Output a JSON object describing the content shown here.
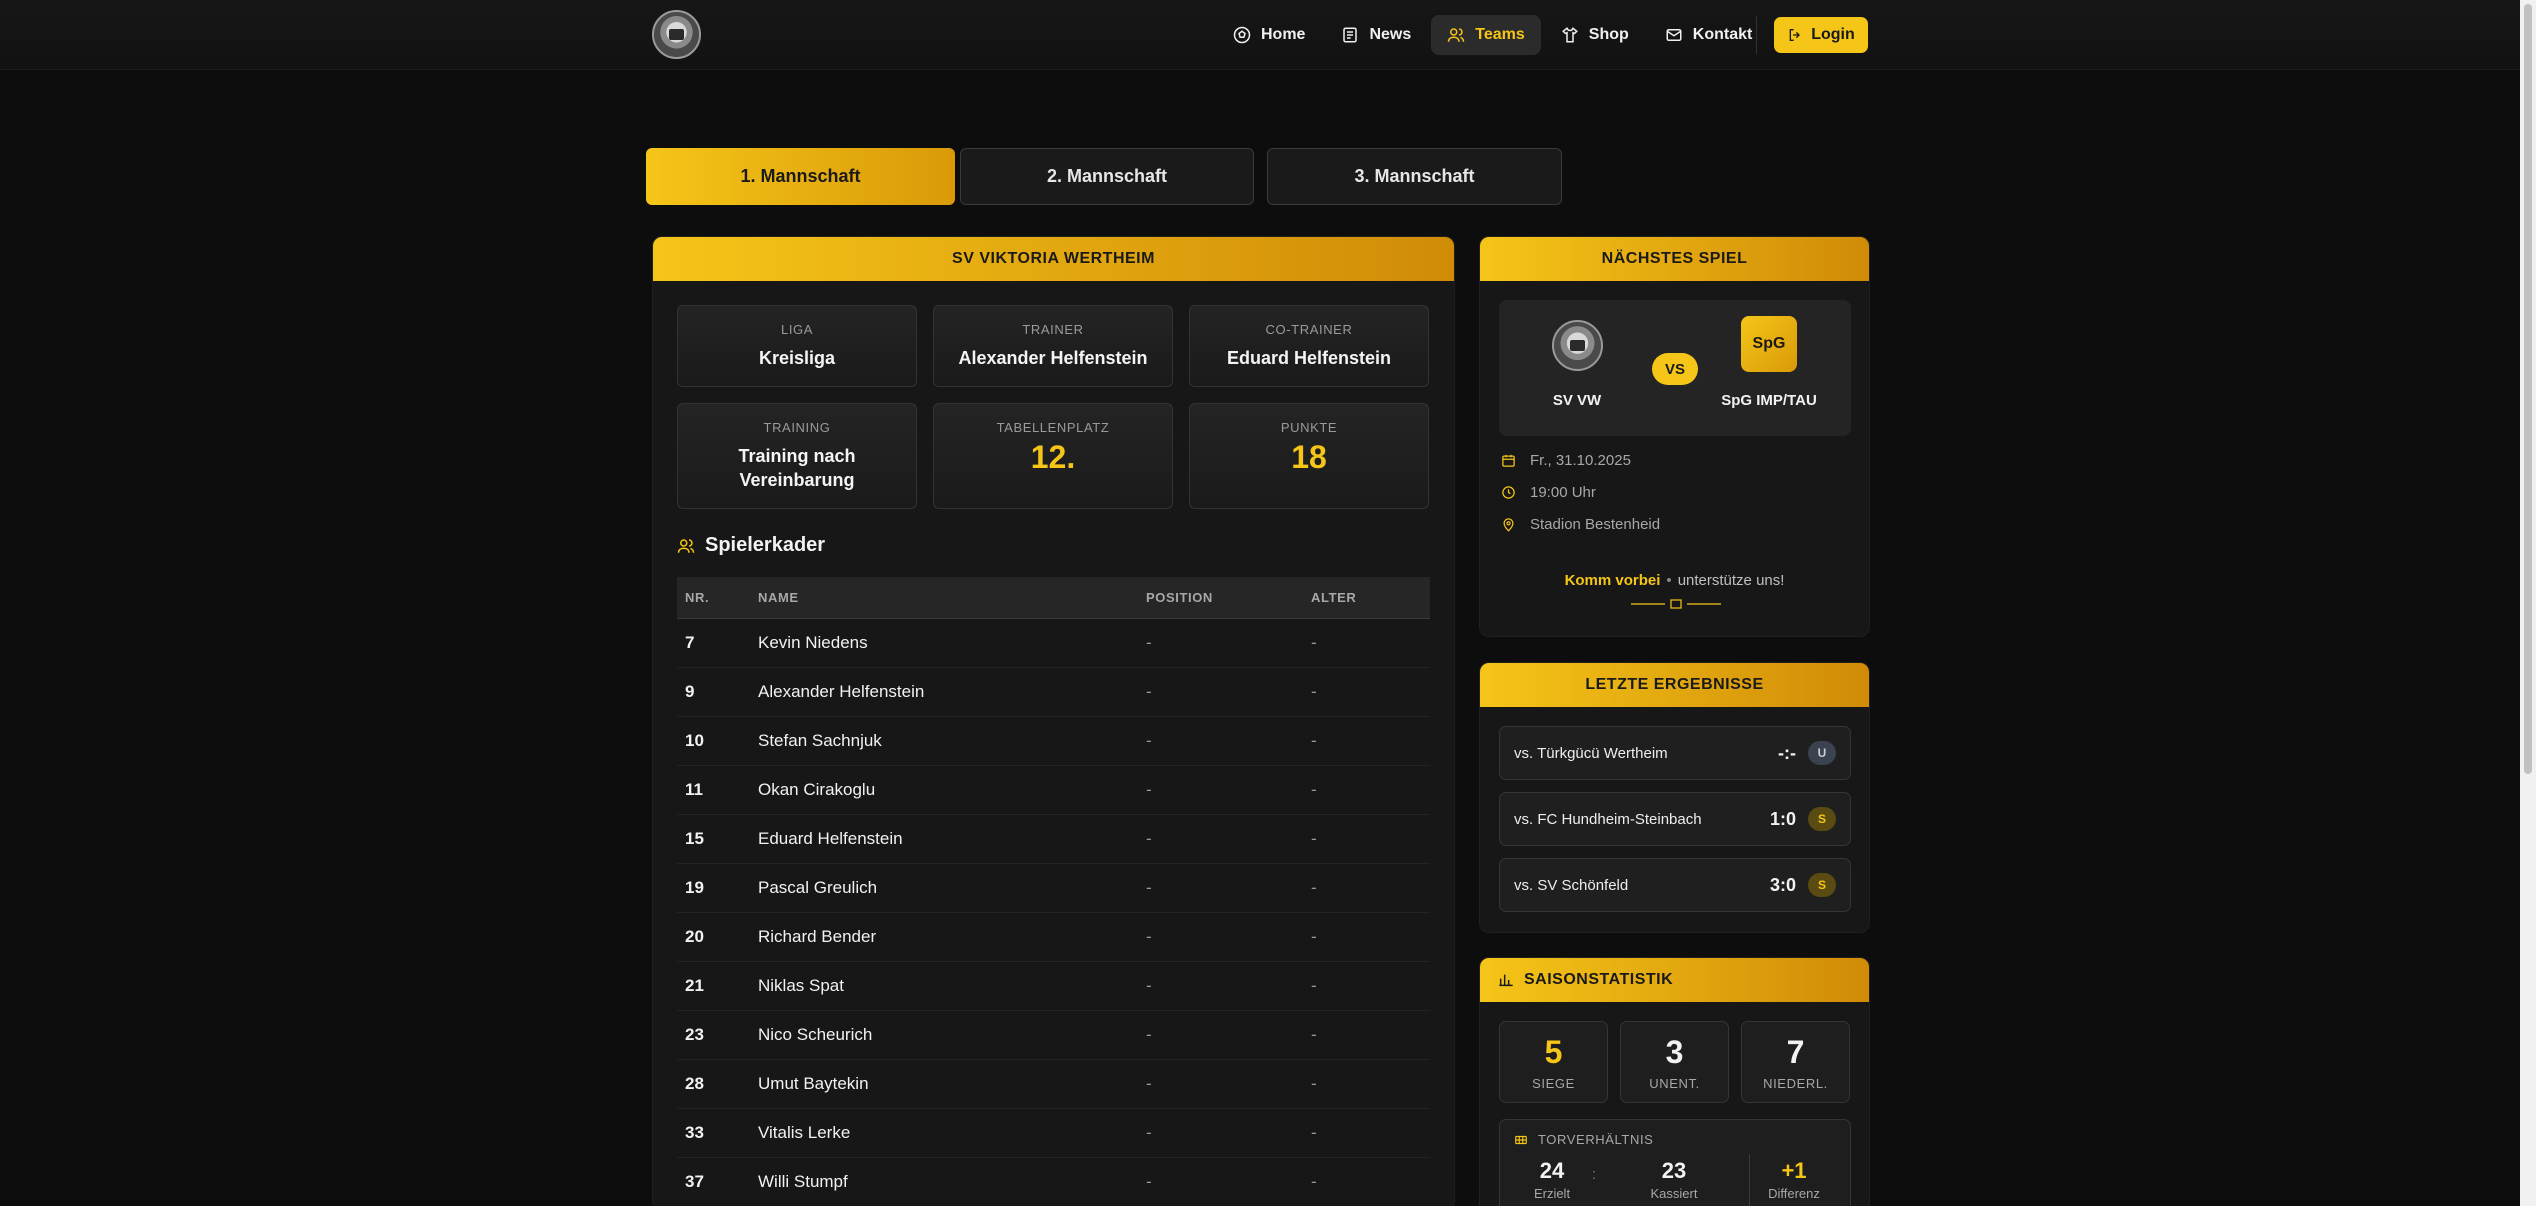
{
  "nav": {
    "items": [
      {
        "label": "Home",
        "icon": "soccer-ball-icon"
      },
      {
        "label": "News",
        "icon": "newspaper-icon"
      },
      {
        "label": "Teams",
        "icon": "users-icon",
        "active": true
      },
      {
        "label": "Shop",
        "icon": "shirt-icon"
      },
      {
        "label": "Kontakt",
        "icon": "mail-icon"
      }
    ],
    "login_label": "Login"
  },
  "tabs": [
    "1. Mannschaft",
    "2. Mannschaft",
    "3. Mannschaft"
  ],
  "team": {
    "header": "SV VIKTORIA WERTHEIM",
    "info": [
      {
        "label": "Liga",
        "value": "Kreisliga"
      },
      {
        "label": "Trainer",
        "value": "Alexander Helfenstein"
      },
      {
        "label": "Co-Trainer",
        "value": "Eduard Helfenstein"
      },
      {
        "label": "Training",
        "value": "Training nach Vereinbarung"
      },
      {
        "label": "Tabellenplatz",
        "value": "12."
      },
      {
        "label": "Punkte",
        "value": "18"
      }
    ],
    "squad_title": "Spielerkader",
    "columns": [
      "NR.",
      "NAME",
      "POSITION",
      "ALTER"
    ],
    "players": [
      {
        "nr": "7",
        "name": "Kevin Niedens",
        "position": "-",
        "age": "-"
      },
      {
        "nr": "9",
        "name": "Alexander Helfenstein",
        "position": "-",
        "age": "-"
      },
      {
        "nr": "10",
        "name": "Stefan Sachnjuk",
        "position": "-",
        "age": "-"
      },
      {
        "nr": "11",
        "name": "Okan Cirakoglu",
        "position": "-",
        "age": "-"
      },
      {
        "nr": "15",
        "name": "Eduard Helfenstein",
        "position": "-",
        "age": "-"
      },
      {
        "nr": "19",
        "name": "Pascal Greulich",
        "position": "-",
        "age": "-"
      },
      {
        "nr": "20",
        "name": "Richard Bender",
        "position": "-",
        "age": "-"
      },
      {
        "nr": "21",
        "name": "Niklas Spat",
        "position": "-",
        "age": "-"
      },
      {
        "nr": "23",
        "name": "Nico Scheurich",
        "position": "-",
        "age": "-"
      },
      {
        "nr": "28",
        "name": "Umut Baytekin",
        "position": "-",
        "age": "-"
      },
      {
        "nr": "33",
        "name": "Vitalis Lerke",
        "position": "-",
        "age": "-"
      },
      {
        "nr": "37",
        "name": "Willi Stumpf",
        "position": "-",
        "age": "-"
      }
    ]
  },
  "next_match": {
    "header": "NÄCHSTES SPIEL",
    "home": "SV VW",
    "away_logo": "SpG",
    "away": "SpG IMP/TAU",
    "vs": "VS",
    "date": "Fr., 31.10.2025",
    "time": "19:00 Uhr",
    "venue": "Stadion Bestenheid",
    "cta_bold": "Komm vorbei",
    "cta_rest": "unterstütze uns!"
  },
  "results": {
    "header": "LETZTE ERGEBNISSE",
    "items": [
      {
        "opponent": "vs. Türkgücü Wertheim",
        "score": "-:-",
        "badge": "U"
      },
      {
        "opponent": "vs. FC Hundheim-Steinbach",
        "score": "1:0",
        "badge": "S"
      },
      {
        "opponent": "vs. SV Schönfeld",
        "score": "3:0",
        "badge": "S"
      }
    ]
  },
  "season": {
    "header": "SAISONSTATISTIK",
    "stats": [
      {
        "value": "5",
        "label": "SIEGE"
      },
      {
        "value": "3",
        "label": "UNENT."
      },
      {
        "value": "7",
        "label": "NIEDERL."
      }
    ],
    "goals_title": "TORVERHÄLTNIS",
    "scored": "24",
    "scored_label": "Erzielt",
    "conceded": "23",
    "conceded_label": "Kassiert",
    "separator": ":",
    "diff": "+1",
    "diff_label": "Differenz"
  },
  "colors": {
    "accent": "#f5c518",
    "accent_dark": "#d08b07",
    "background": "#0d0d0d"
  }
}
